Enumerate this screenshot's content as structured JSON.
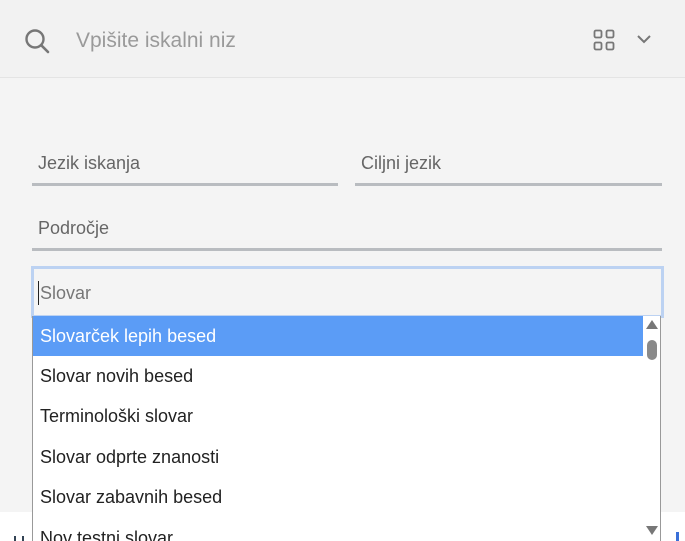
{
  "search": {
    "placeholder": "Vpišite iskalni niz"
  },
  "icons": {
    "search": "search-icon",
    "grid": "grid-view-icon",
    "chevron": "chevron-down-icon"
  },
  "filters": {
    "source_language": "Jezik iskanja",
    "target_language": "Ciljni jezik",
    "area": "Področje",
    "dictionary_placeholder": "Slovar"
  },
  "dropdown": {
    "options": [
      "Slovarček lepih besed",
      "Slovar novih besed",
      "Terminološki slovar",
      "Slovar odprte znanosti",
      "Slovar zabavnih besed",
      "Nov testni slovar"
    ],
    "selected_index": 0
  },
  "colors": {
    "selected_option": "#5b9cf6",
    "focus_border": "#bcd2f2",
    "field_underline": "#b9bcc0"
  }
}
